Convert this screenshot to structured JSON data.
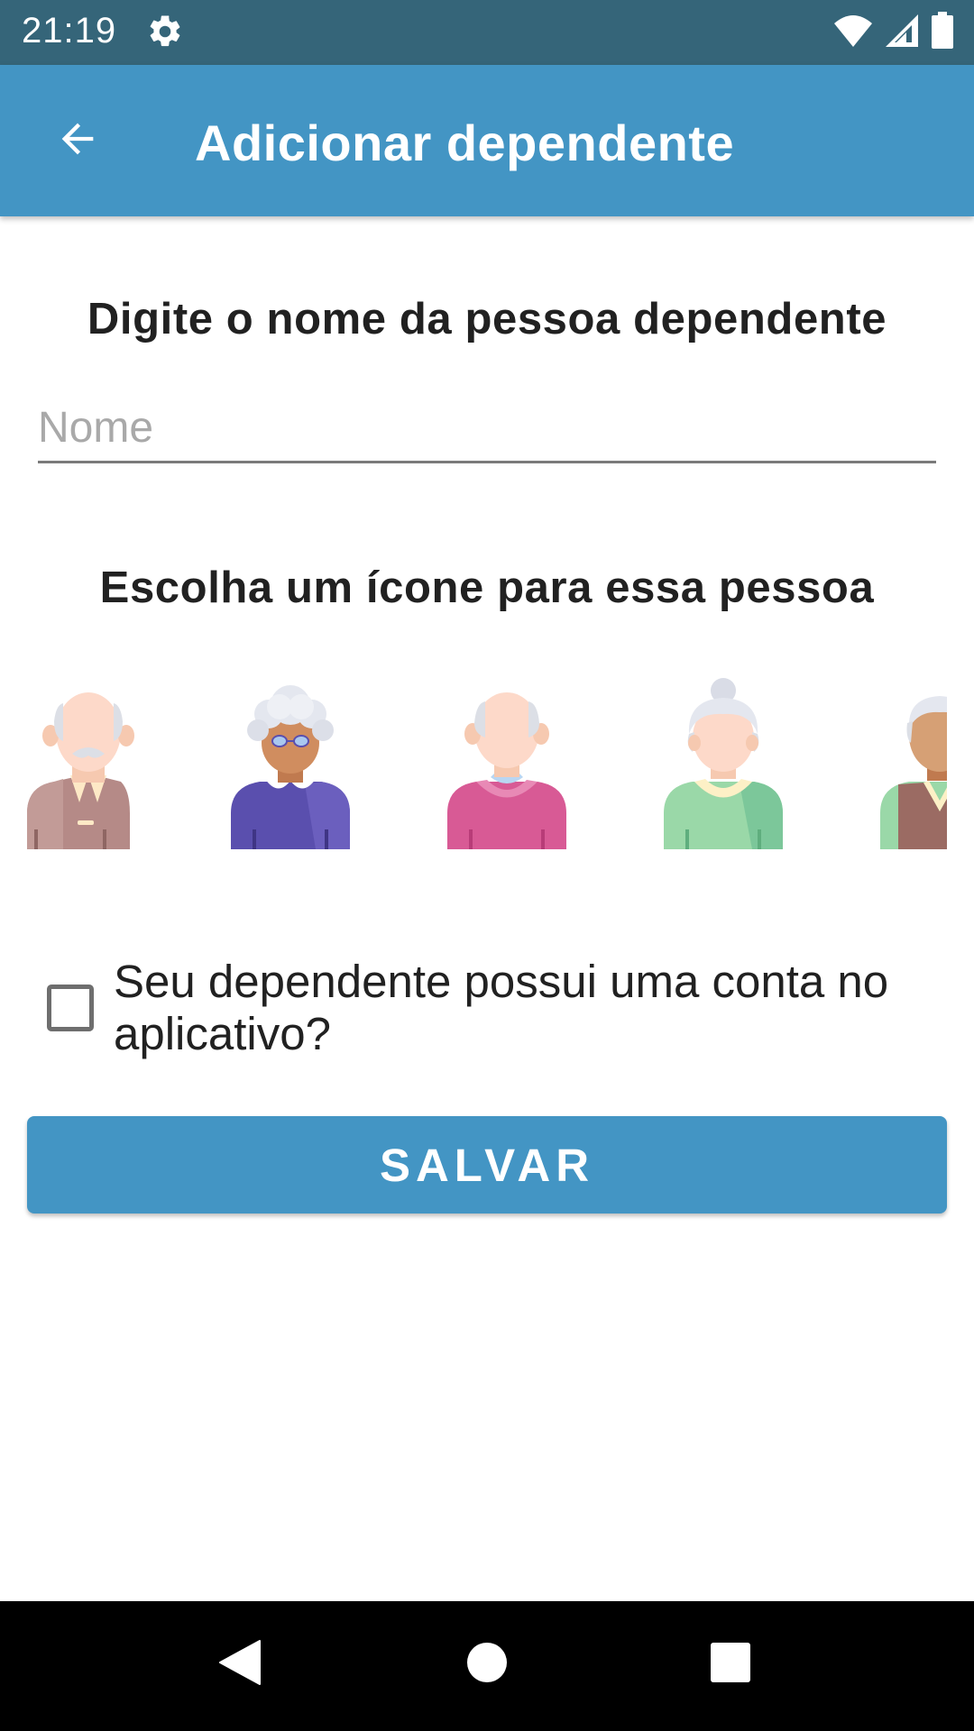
{
  "status_bar": {
    "time": "21:19",
    "icons": [
      "gear-icon",
      "wifi-icon",
      "cell-signal-icon",
      "battery-icon"
    ]
  },
  "app_bar": {
    "back_icon": "arrow-left-icon",
    "title": "Adicionar dependente"
  },
  "form": {
    "name_prompt": "Digite o nome da pessoa dependente",
    "name_placeholder": "Nome",
    "name_value": "",
    "icon_prompt": "Escolha um ícone para essa pessoa",
    "avatars": [
      {
        "id": "elderly-man-bald-mustache",
        "icon": "elderly-man-icon"
      },
      {
        "id": "elderly-woman-curly-glasses",
        "icon": "elderly-woman-icon"
      },
      {
        "id": "elderly-person-bald-pink",
        "icon": "elderly-person-icon"
      },
      {
        "id": "elderly-woman-bun",
        "icon": "elderly-woman-icon"
      },
      {
        "id": "elderly-man-vest",
        "icon": "elderly-man-icon"
      }
    ],
    "has_account_label": "Seu dependente possui uma conta no aplicativo?",
    "has_account_checked": false,
    "save_label": "SALVAR"
  },
  "nav_bar": {
    "buttons": [
      "back-triangle-icon",
      "home-circle-icon",
      "recents-square-icon"
    ]
  },
  "colors": {
    "status_bar": "#356579",
    "primary": "#4395c4",
    "text": "#212121",
    "placeholder": "#a9a9a9"
  }
}
